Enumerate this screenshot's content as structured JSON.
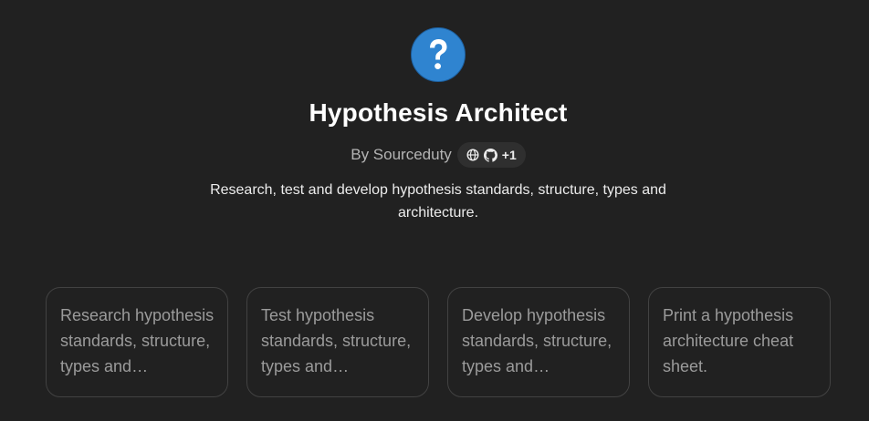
{
  "gpt": {
    "avatar_icon": "question-mark-icon",
    "title": "Hypothesis Architect",
    "byline": "By Sourceduty",
    "social": {
      "icons": [
        "globe-icon",
        "github-icon"
      ],
      "extra_count": "+1"
    },
    "description": "Research, test and develop hypothesis standards, structure, types and architecture."
  },
  "conversation_starters": [
    {
      "label": "Research hypothesis standards, structure, types and architecture."
    },
    {
      "label": "Test hypothesis standards, structure, types and architecture."
    },
    {
      "label": "Develop hypothesis standards, structure, types and architecture."
    },
    {
      "label": "Print a hypothesis architecture cheat sheet."
    }
  ],
  "colors": {
    "background": "#212121",
    "avatar": "#2f84d0",
    "card_border": "#424242"
  }
}
